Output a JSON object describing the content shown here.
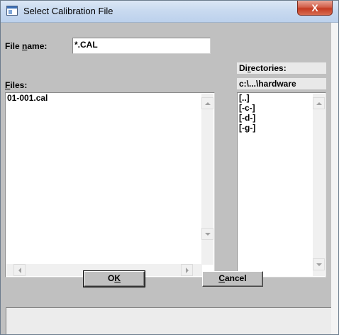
{
  "window": {
    "title": "Select Calibration File",
    "close_glyph": "X"
  },
  "file_name": {
    "label_pre": "File ",
    "label_accel": "n",
    "label_post": "ame:",
    "value": "*.CAL"
  },
  "files": {
    "label_accel": "F",
    "label_post": "iles:",
    "items": [
      "01-001.cal"
    ]
  },
  "directories": {
    "label_pre": "Di",
    "label_accel": "r",
    "label_post": "ectories:",
    "current_path": "c:\\...\\hardware",
    "items": [
      "[..]",
      "[-c-]",
      "[-d-]",
      "[-g-]"
    ]
  },
  "buttons": {
    "ok_pre": "O",
    "ok_accel": "K",
    "cancel_accel": "C",
    "cancel_post": "ancel"
  },
  "icons": {
    "app": "window-icon",
    "close": "close-icon",
    "scroll_up": "scroll-up-arrow-icon",
    "scroll_down": "scroll-down-arrow-icon",
    "scroll_left": "scroll-left-arrow-icon",
    "scroll_right": "scroll-right-arrow-icon"
  }
}
